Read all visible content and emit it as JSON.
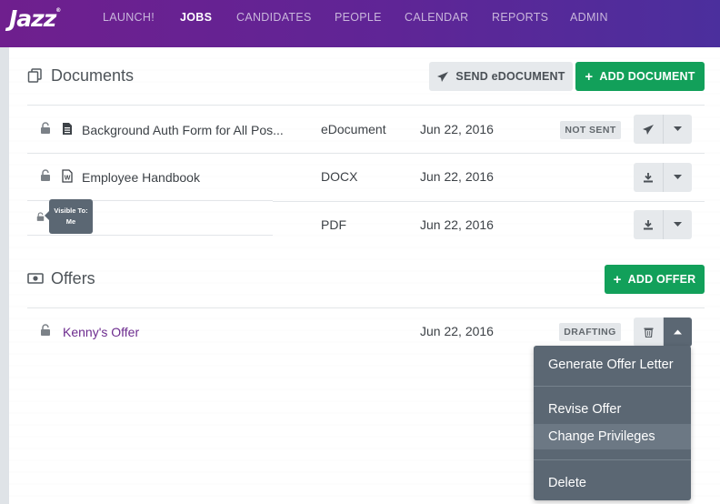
{
  "nav": {
    "logo": "Jazz",
    "logo_mark": "®",
    "items": [
      {
        "label": "LAUNCH!",
        "active": false
      },
      {
        "label": "JOBS",
        "active": true
      },
      {
        "label": "CANDIDATES",
        "active": false
      },
      {
        "label": "PEOPLE",
        "active": false
      },
      {
        "label": "CALENDAR",
        "active": false
      },
      {
        "label": "REPORTS",
        "active": false
      },
      {
        "label": "ADMIN",
        "active": false
      }
    ]
  },
  "documents": {
    "title": "Documents",
    "send_label": "SEND eDOCUMENT",
    "add_label": "ADD DOCUMENT",
    "rows": [
      {
        "name": "Background Auth Form for All Pos...",
        "type": "eDocument",
        "date": "Jun 22, 2016",
        "status": "NOT SENT",
        "file_icon": "document-icon",
        "action_icon": "send-icon"
      },
      {
        "name": "Employee Handbook",
        "type": "DOCX",
        "date": "Jun 22, 2016",
        "status": "",
        "file_icon": "word-file-icon",
        "action_icon": "download-icon"
      },
      {
        "name": "",
        "type": "PDF",
        "date": "Jun 22, 2016",
        "status": "",
        "file_icon": "",
        "action_icon": "download-icon"
      }
    ]
  },
  "tooltip": {
    "line1": "Visible To:",
    "line2": "Me"
  },
  "offers": {
    "title": "Offers",
    "add_label": "ADD OFFER",
    "rows": [
      {
        "name": "Kenny's Offer",
        "date": "Jun 22, 2016",
        "status": "DRAFTING"
      }
    ]
  },
  "offer_menu": {
    "items": [
      "Generate Offer Letter",
      "Revise Offer",
      "Change Privileges",
      "Delete"
    ]
  },
  "colors": {
    "nav_gradient_start": "#6f1f8e",
    "nav_gradient_end": "#4b2f9d",
    "green": "#12a05a",
    "offer_link": "#6c2b8e",
    "menu_bg": "#5b6773"
  }
}
